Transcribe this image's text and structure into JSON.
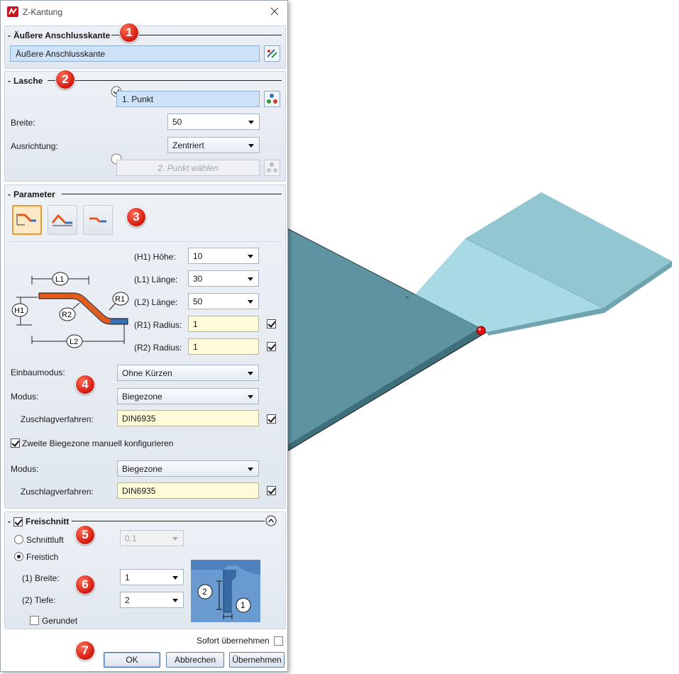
{
  "window": {
    "title": "Z-Kantung"
  },
  "sections": {
    "outer_edge": {
      "title": "Äußere Anschlusskante",
      "field_value": "Äußere Anschlusskante"
    },
    "tab": {
      "title": "Lasche",
      "point1_value": "1. Punkt",
      "width_label": "Breite:",
      "width_value": "50",
      "alignment_label": "Ausrichtung:",
      "alignment_value": "Zentriert",
      "point2_value": "2. Punkt wählen"
    },
    "parameters": {
      "title": "Parameter",
      "rows": [
        {
          "label": "(H1) Höhe:",
          "value": "10"
        },
        {
          "label": "(L1) Länge:",
          "value": "30"
        },
        {
          "label": "(L2) Länge:",
          "value": "50"
        },
        {
          "label": "(R1) Radius:",
          "value": "1"
        },
        {
          "label": "(R2) Radius:",
          "value": "1"
        }
      ],
      "diagram_labels": {
        "h1": "H1",
        "l1": "L1",
        "l2": "L2",
        "r1": "R1",
        "r2": "R2"
      },
      "install_mode_label": "Einbaumodus:",
      "install_mode_value": "Ohne Kürzen",
      "mode_label": "Modus:",
      "mode_value": "Biegezone",
      "allowance_label": "Zuschlagverfahren:",
      "allowance_value": "DIN6935",
      "second_zone_label": "Zweite Biegezone manuell konfigurieren",
      "mode2_label": "Modus:",
      "mode2_value": "Biegezone",
      "allowance2_label": "Zuschlagverfahren:",
      "allowance2_value": "DIN6935"
    },
    "relief": {
      "title": "Freischnitt",
      "clearance_label": "Schnittluft",
      "clearance_value": "0.1",
      "relief_label": "Freistich",
      "width_label": "(1) Breite:",
      "width_value": "1",
      "depth_label": "(2) Tiefe:",
      "depth_value": "2",
      "rounded_label": "Gerundet",
      "illus_label_1": "1",
      "illus_label_2": "2"
    }
  },
  "footer": {
    "apply_immediately_label": "Sofort übernehmen",
    "ok_label": "OK",
    "cancel_label": "Abbrechen",
    "apply_label": "Übernehmen"
  },
  "badges": [
    "1",
    "2",
    "3",
    "4",
    "5",
    "6",
    "7"
  ],
  "colors": {
    "accent_orange": "#e89b2f",
    "badge_red": "#d11a10",
    "field_blue": "#cfe3f8",
    "field_yellow": "#fdfbd8",
    "plate_dark": "#5e94a2",
    "plate_light": "#a8dae5"
  }
}
